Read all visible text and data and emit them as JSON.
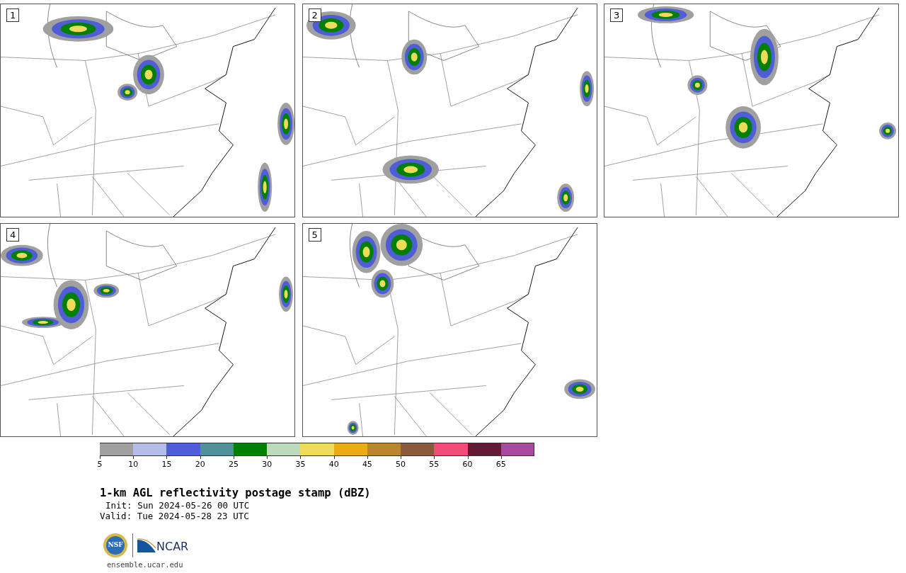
{
  "panels": [
    {
      "label": "1"
    },
    {
      "label": "2"
    },
    {
      "label": "3"
    },
    {
      "label": "4"
    },
    {
      "label": "5"
    }
  ],
  "colorbar": {
    "segments": [
      {
        "label": "5",
        "color": "#a0a0a0"
      },
      {
        "label": "10",
        "color": "#b4bdea"
      },
      {
        "label": "15",
        "color": "#4f5dd6"
      },
      {
        "label": "20",
        "color": "#4d9399"
      },
      {
        "label": "25",
        "color": "#008000"
      },
      {
        "label": "30",
        "color": "#bcdbbb"
      },
      {
        "label": "35",
        "color": "#eedb5a"
      },
      {
        "label": "40",
        "color": "#edab13"
      },
      {
        "label": "45",
        "color": "#bd8430"
      },
      {
        "label": "50",
        "color": "#8b5a3c"
      },
      {
        "label": "55",
        "color": "#f24d78"
      },
      {
        "label": "60",
        "color": "#661935"
      },
      {
        "label": "65",
        "color": "#a9489f"
      }
    ]
  },
  "title": "1-km AGL reflectivity postage stamp (dBZ)",
  "init": "Init: Sun 2024-05-26 00 UTC",
  "valid": "Valid: Tue 2024-05-28 23 UTC",
  "logos": {
    "nsf": "NSF",
    "ncar": "NCAR"
  },
  "footer_link": "ensemble.ucar.edu"
}
